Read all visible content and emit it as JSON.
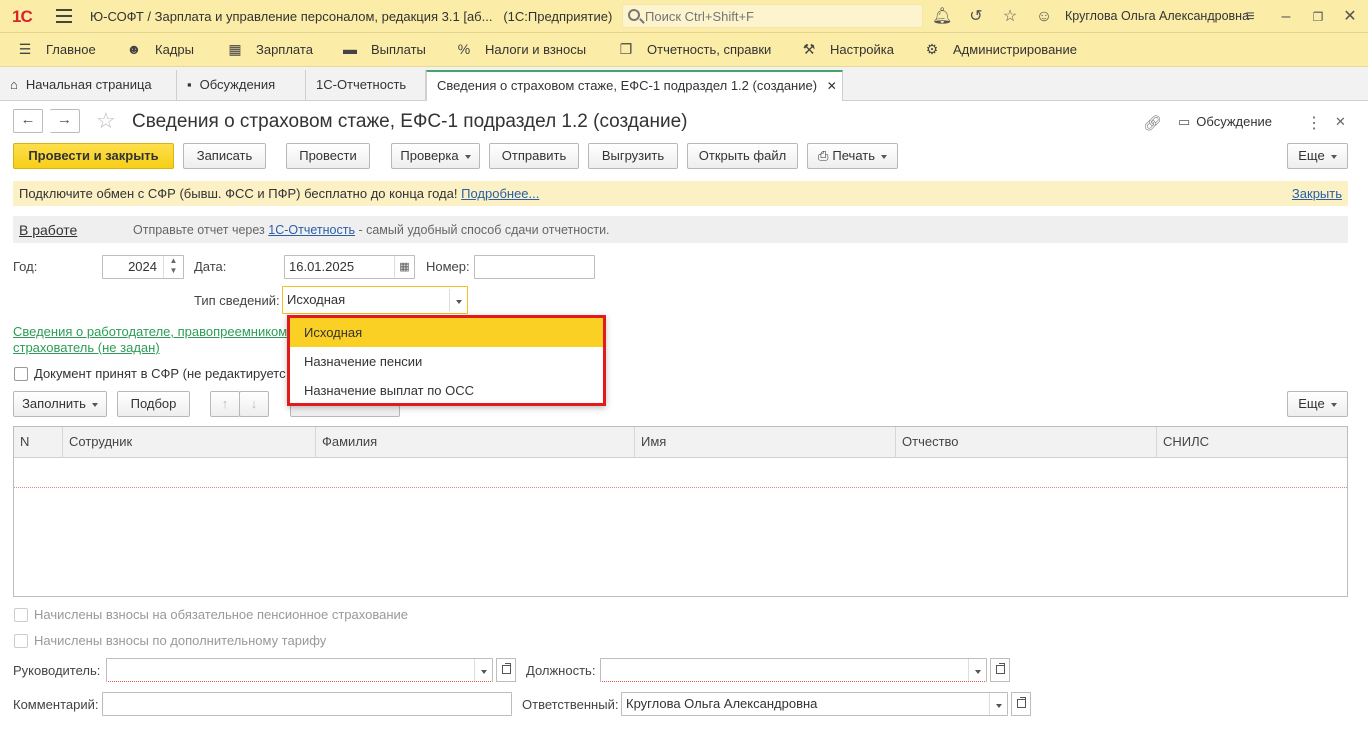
{
  "titlebar": {
    "logo": "1С",
    "app_title": "Ю-СОФТ / Зарплата и управление персоналом, редакция 3.1 [аб...",
    "platform": "(1С:Предприятие)",
    "search_placeholder": "Поиск Ctrl+Shift+F",
    "user_name": "Круглова Ольга Александровна"
  },
  "menu": [
    {
      "label": "Главное",
      "icon": "burger-icon"
    },
    {
      "label": "Кадры",
      "icon": "people-icon"
    },
    {
      "label": "Зарплата",
      "icon": "calculator-icon"
    },
    {
      "label": "Выплаты",
      "icon": "wallet-icon"
    },
    {
      "label": "Налоги и взносы",
      "icon": "percent-icon"
    },
    {
      "label": "Отчетность, справки",
      "icon": "documents-icon"
    },
    {
      "label": "Настройка",
      "icon": "wrench-icon"
    },
    {
      "label": "Администрирование",
      "icon": "gear-icon"
    }
  ],
  "tabs": [
    {
      "label": "Начальная страница"
    },
    {
      "label": "Обсуждения"
    },
    {
      "label": "1С-Отчетность"
    },
    {
      "label": "Сведения о страховом стаже, ЕФС-1 подраздел 1.2 (создание)"
    }
  ],
  "form": {
    "title": "Сведения о страховом стаже, ЕФС-1 подраздел 1.2 (создание)",
    "discussion": "Обсуждение",
    "buttons": {
      "post_close": "Провести и закрыть",
      "save": "Записать",
      "post": "Провести",
      "check": "Проверка",
      "send": "Отправить",
      "upload": "Выгрузить",
      "open_file": "Открыть файл",
      "print": "Печать",
      "more": "Еще"
    },
    "notice": {
      "text": "Подключите обмен с СФР (бывш. ФСС и ПФР) бесплатно до конца года!",
      "more_link": "Подробнее...",
      "close_link": "Закрыть"
    },
    "status": {
      "label": "В работе",
      "hint_before": "Отправьте отчет через",
      "hint_link": "1С-Отчетность",
      "hint_after": "- самый удобный способ сдачи отчетности."
    },
    "fields": {
      "year_label": "Год:",
      "year_value": "2024",
      "date_label": "Дата:",
      "date_value": "16.01.2025",
      "number_label": "Номер:",
      "number_value": "",
      "type_label": "Тип сведений:",
      "type_value": "Исходная"
    },
    "employer_link_line1": "Сведения о работодателе, правопреемником",
    "employer_link_line2": "страхователь (не задан)",
    "accepted_checkbox": "Документ принят в СФР (не редактируетс",
    "table_buttons": {
      "fill": "Заполнить",
      "pick": "Подбор",
      "more": "Еще"
    },
    "dropdown": {
      "options": [
        "Исходная",
        "Назначение пенсии",
        "Назначение выплат по ОСС"
      ],
      "selected": "Исходная"
    },
    "table": {
      "columns": [
        "N",
        "Сотрудник",
        "Фамилия",
        "Имя",
        "Отчество",
        "СНИЛС"
      ],
      "rows": []
    },
    "bottom": {
      "chk_pension": "Начислены взносы на обязательное пенсионное страхование",
      "chk_extra": "Начислены взносы по дополнительному тарифу",
      "head_label": "Руководитель:",
      "head_value": "",
      "position_label": "Должность:",
      "position_value": "",
      "comment_label": "Комментарий:",
      "comment_value": "",
      "responsible_label": "Ответственный:",
      "responsible_value": "Круглова Ольга Александровна"
    }
  },
  "colors": {
    "header_bg": "#fbeca8",
    "primary_button": "#f7cf17",
    "dropdown_highlight": "#e41a1a",
    "selected_option": "#fbd024",
    "link": "#2a5fa8",
    "green_link": "#2c9d55"
  }
}
